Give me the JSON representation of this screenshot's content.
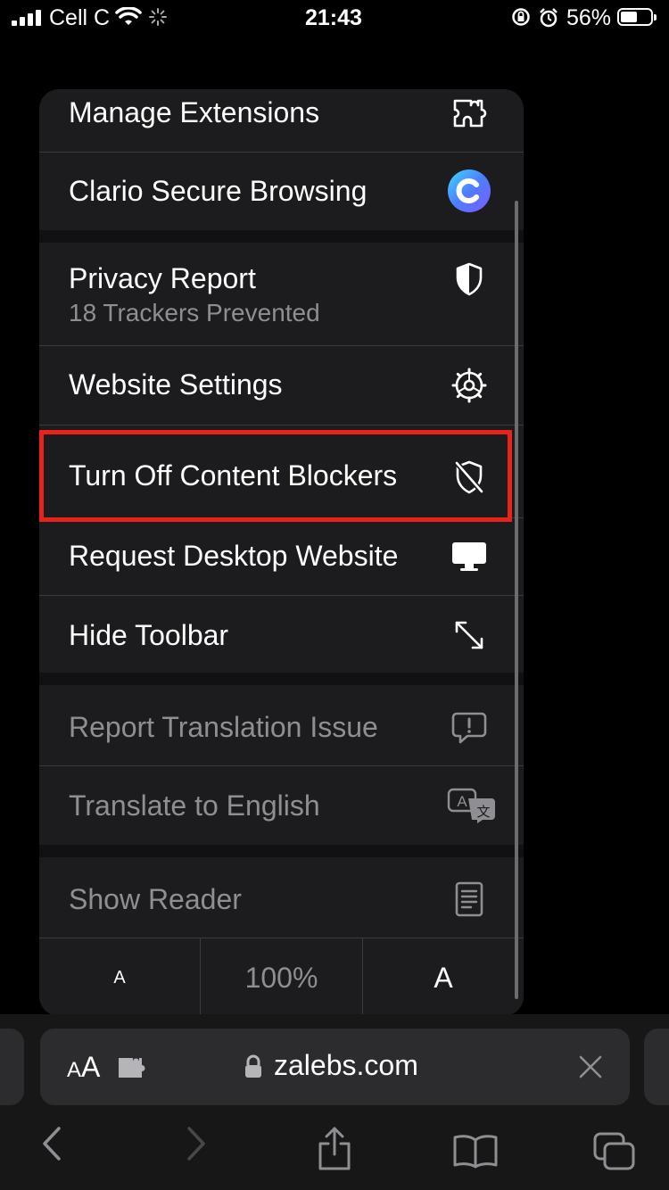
{
  "status_bar": {
    "carrier": "Cell C",
    "time": "21:43",
    "battery_percent": "56%",
    "battery_level": 0.56,
    "icons": [
      "signal-icon",
      "wifi-icon",
      "activity-spinner-icon",
      "rotation-lock-icon",
      "alarm-icon",
      "battery-icon"
    ]
  },
  "menu": {
    "items": [
      {
        "label": "Manage Extensions",
        "icon": "extensions-icon"
      },
      {
        "label": "Clario Secure Browsing",
        "icon": "clario-logo-icon"
      },
      {
        "label": "Privacy Report",
        "subtitle": "18 Trackers Prevented",
        "icon": "shield-icon"
      },
      {
        "label": "Website Settings",
        "icon": "gear-icon"
      },
      {
        "label": "Turn Off Content Blockers",
        "icon": "shield-slash-icon"
      },
      {
        "label": "Request Desktop Website",
        "icon": "desktop-icon"
      },
      {
        "label": "Hide Toolbar",
        "icon": "expand-arrows-icon"
      },
      {
        "label": "Report Translation Issue",
        "icon": "exclamation-bubble-icon"
      },
      {
        "label": "Translate to English",
        "icon": "translate-icon"
      },
      {
        "label": "Show Reader",
        "icon": "reader-icon"
      }
    ],
    "zoom": {
      "decrease_label": "A",
      "level": "100%",
      "increase_label": "A"
    }
  },
  "address_bar": {
    "format_small": "A",
    "format_big": "A",
    "domain": "zalebs.com"
  },
  "colors": {
    "highlight": "#e8231b",
    "menu_bg": "#1c1c1e",
    "dim_text": "#8e8e93"
  }
}
